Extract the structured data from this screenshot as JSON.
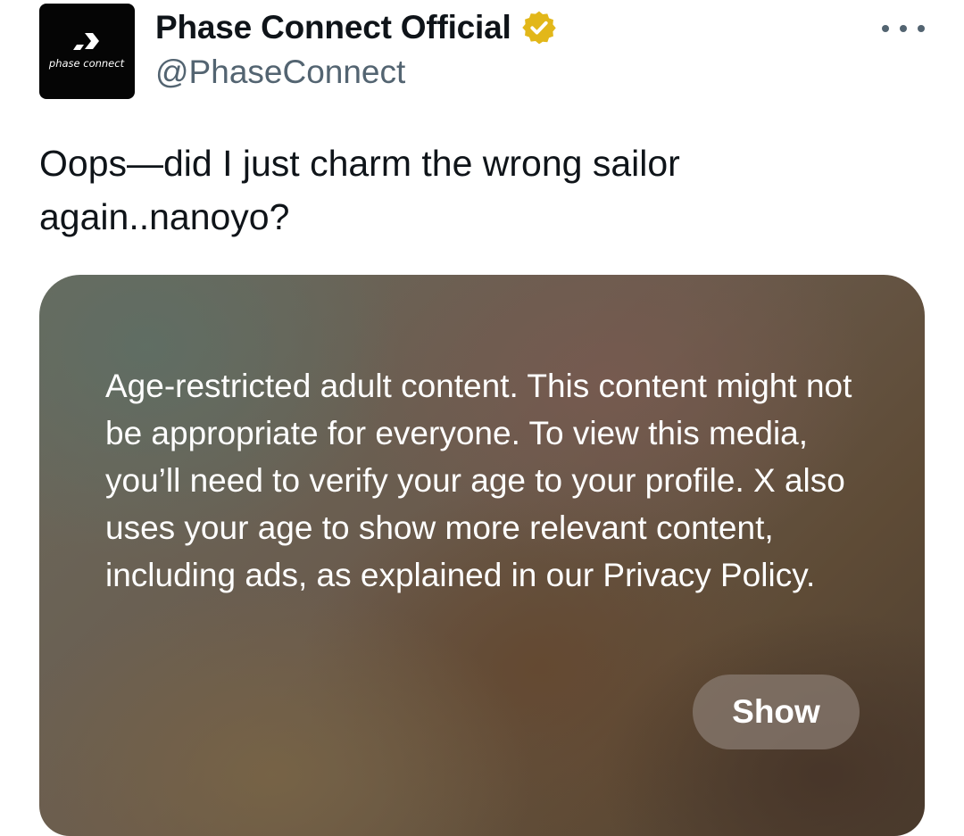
{
  "post": {
    "author": {
      "display_name": "Phase Connect Official",
      "handle": "@PhaseConnect",
      "verified": true,
      "verified_color": "#e2b719",
      "avatar_logo_text": "phase connect"
    },
    "more_icon": "more-horizontal-icon",
    "text": "Oops—did I just charm the wrong sailor again..nanoyo?",
    "media_warning": {
      "text": "Age-restricted adult content. This content might not be appropriate for everyone. To view this media, you’ll need to verify your age to your profile. X also uses your age to show more relevant content, including ads, as explained in our Privacy Policy.",
      "show_button_label": "Show"
    }
  }
}
